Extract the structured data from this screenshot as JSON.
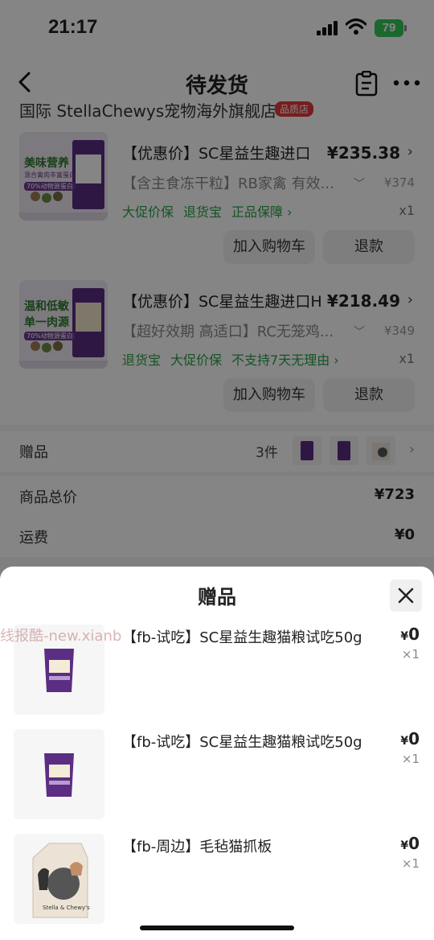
{
  "status_bar": {
    "time": "21:17",
    "battery": "79"
  },
  "header": {
    "title": "待发货"
  },
  "store": {
    "name": "国际 StellaChewys宠物海外旗舰店",
    "tag": "品质店"
  },
  "products": [
    {
      "title": "【优惠价】SC星益生趣进口",
      "price": "¥235.38",
      "spec": "【含主食冻干粒】RB家禽 有效...",
      "original_price": "¥374",
      "services": [
        "大促价保",
        "退货宝",
        "正品保障 ›"
      ],
      "quantity": "x1",
      "image_text": [
        "美味营养",
        "混合禽肉丰富蛋白",
        "70%动物源蛋白"
      ],
      "add_cart_label": "加入购物车",
      "refund_label": "退款"
    },
    {
      "title": "【优惠价】SC星益生趣进口H",
      "price": "¥218.49",
      "spec": "【超好效期 高适口】RC无笼鸡...",
      "original_price": "¥349",
      "services": [
        "退货宝",
        "大促价保",
        "不支持7天无理由 ›"
      ],
      "quantity": "x1",
      "image_text": [
        "温和低敏",
        "单一肉源",
        "70%动物源蛋白"
      ],
      "add_cart_label": "加入购物车",
      "refund_label": "退款"
    }
  ],
  "gift_row": {
    "label": "赠品",
    "count": "3件"
  },
  "total_row": {
    "label": "商品总价",
    "value": "¥723"
  },
  "shipping_row": {
    "label": "运费",
    "value": "¥0"
  },
  "sheet": {
    "title": "赠品",
    "watermark": "线报酷-new.xianb",
    "items": [
      {
        "name": "【fb-试吃】SC星益生趣猫粮试吃50g",
        "currency": "¥",
        "price": "0",
        "qty": "×1",
        "kind": "bag"
      },
      {
        "name": "【fb-试吃】SC星益生趣猫粮试吃50g",
        "currency": "¥",
        "price": "0",
        "qty": "×1",
        "kind": "bag"
      },
      {
        "name": "【fb-周边】毛毡猫抓板",
        "currency": "¥",
        "price": "0",
        "qty": "×1",
        "kind": "box",
        "brand": "Stella & Chewy's"
      }
    ]
  },
  "colors": {
    "service_green": "#2aa146",
    "tag_red": "#e4393c",
    "battery_green": "#35c759",
    "bag_purple": "#5b2d83"
  }
}
